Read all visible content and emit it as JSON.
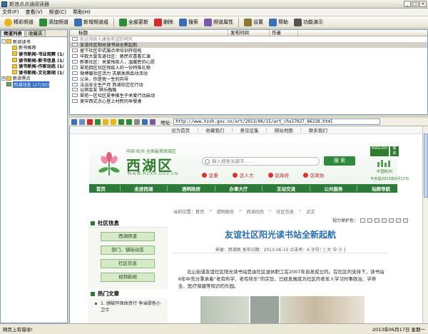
{
  "window": {
    "title": "新浪点点通阅读器",
    "min": "_",
    "max": "□",
    "close": "×"
  },
  "menu": [
    "文件(F)",
    "查看(V)",
    "频道(C)",
    "帮助(H)"
  ],
  "toolbar": [
    {
      "label": "精彩频道",
      "icon": "star-icon",
      "color": "#e8b51a"
    },
    {
      "label": "添加频道",
      "icon": "add-channel-icon",
      "color": "#2e8b3a"
    },
    {
      "label": "新增频道组",
      "icon": "new-group-icon",
      "color": "#3b6fb5"
    },
    {
      "label": "全部更新",
      "icon": "refresh-icon",
      "color": "#2e8b3a"
    },
    {
      "label": "删除",
      "icon": "delete-icon",
      "color": "#d12b2b"
    },
    {
      "label": "搜索",
      "icon": "search-icon",
      "color": "#3b6fb5"
    },
    {
      "label": "频道属性",
      "icon": "properties-icon",
      "color": "#7a5aa8"
    },
    {
      "label": "设置",
      "icon": "gear-icon",
      "color": "#8a7a30"
    },
    {
      "label": "帮助",
      "icon": "help-icon",
      "color": "#3b6fb5"
    },
    {
      "label": "功能演示",
      "icon": "demo-icon",
      "color": "#555555"
    }
  ],
  "left": {
    "tabs": [
      "频道列表",
      "收藏夹"
    ],
    "tree": [
      {
        "label": "新浪读书",
        "level": 0,
        "ex": "-",
        "green": false,
        "sel": false
      },
      {
        "label": "新书推荐",
        "level": 1,
        "ex": "",
        "green": false,
        "sel": false
      },
      {
        "label": "读书新闻-书业观察 (1/",
        "level": 1,
        "ex": "",
        "green": false,
        "sel": false
      },
      {
        "label": "读书新闻-新书信息 (1/",
        "level": 1,
        "ex": "",
        "green": false,
        "sel": false
      },
      {
        "label": "读书新闻-作家动态 (1/",
        "level": 1,
        "ex": "",
        "green": false,
        "sel": false
      },
      {
        "label": "读书新闻-文化新闻 (1/",
        "level": 1,
        "ex": "",
        "green": false,
        "sel": false
      },
      {
        "label": "新浪黑点",
        "level": 0,
        "ex": "+",
        "green": false,
        "sel": false
      },
      {
        "label": "西湖动态 (27/30)",
        "level": 0,
        "ex": "",
        "green": true,
        "sel": true
      }
    ]
  },
  "list": {
    "headers": [
      "标题",
      "发布时间",
      "作者"
    ],
    "rows": [
      {
        "title": "凯达残疾人康复希望的明天",
        "sel": false
      },
      {
        "title": "友谊社区阳光读书站全新起航",
        "sel": true
      },
      {
        "title": "留下社区中式服点师培训开班啦",
        "sel": false
      },
      {
        "title": "华数大厦车道社区：尾民欢喜看汇演",
        "sel": false
      },
      {
        "title": "新豪社区：关爱残疾人，温暖民的心愿",
        "sel": false
      },
      {
        "title": "翠苑四区社区残疾人的一份特殊礼物",
        "sel": false
      },
      {
        "title": "微博暖社区活力 古朝发质品动活动",
        "sel": false
      },
      {
        "title": "父亲，你是我一生的向导",
        "sel": false
      },
      {
        "title": "法治安全生产月 西湖社区在行动",
        "sel": false
      },
      {
        "title": "以棋会友 棋乐融融",
        "sel": false
      },
      {
        "title": "翠苑一区社区夏季推生于关爱行动启动",
        "sel": false
      },
      {
        "title": "美华西式点心登上村民的早餐桌",
        "sel": false
      }
    ]
  },
  "browser": {
    "addr_label": "地址:",
    "url": "http://www.hzxh.gov.cn/art/2013/06/15/art_chs17027_66228.html"
  },
  "page": {
    "topnav": [
      "设为首页",
      "收藏我们",
      "意见征集",
      "网站地图",
      "联系我们"
    ],
    "site_name": "西湖区",
    "site_sub": "中国·杭州  全国最美丽城区",
    "site_url": "WWW.HZXH.GOV.CN",
    "search_placeholder": "输入搜索关键字……",
    "search_btn": "搜 索",
    "quicklinks": [
      "区委",
      "区人大",
      "区政府",
      "区政协"
    ],
    "eng": [
      "ENGLISH",
      "繁体"
    ],
    "city": "中国杭州",
    "date": "今天是2013年6月17日",
    "mainnav": [
      "首页",
      "走进西湖",
      "透明政府",
      "办事大厅",
      "互动交流",
      "公共服务",
      "站群导航"
    ],
    "crumbs": [
      "当前位置：首页",
      "透明政府",
      "西湖动态",
      "社区信息",
      "正文"
    ],
    "viewprot": "视力保护色：",
    "viewcolors": [
      "#ffffff",
      "#f0f6e8",
      "#f8f1dd",
      "#eaf0f8",
      "#f7e9ec",
      "#e9eef0",
      "#f1ece2"
    ],
    "side_head": "社区信息",
    "side_btns": [
      "西湖频道",
      "部门、镇街动态",
      "社区信息",
      "视频新闻"
    ],
    "hot_head": "热门文章",
    "hot_items": [
      "1. 颁破环保体资行 争当绿色小卫士"
    ],
    "title": "友谊社区阳光读书站全新起航",
    "meta": "来源：西湖网    发布日期：2013-06-15    点击率：6      字号：[ 大 中 小 ]",
    "body": "北山街道友谊社区阳光读书站是由社区退休职工在2007年自发成立的。在社区的支持下，读书站6年中充分秉承着“老有所学、老有所乐”的宗旨，已经发展成为社区的老年人学习时事政治、学养生、医疗保健等知识的乐园。"
  },
  "status": {
    "left": "网页上有错误!",
    "right": "2013年06月17日 星期一"
  }
}
